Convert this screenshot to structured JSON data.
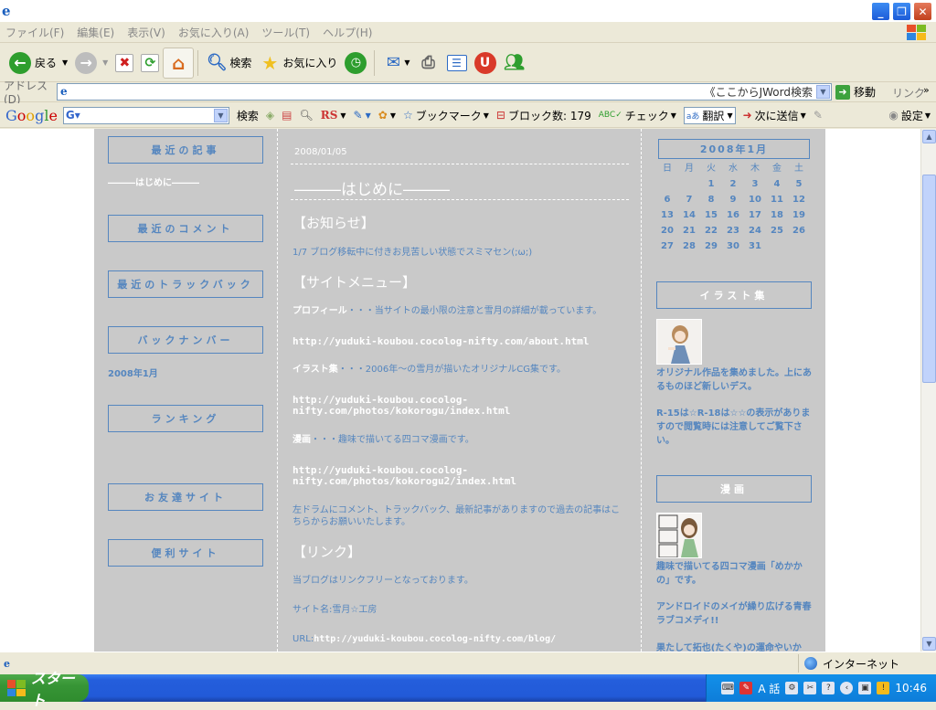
{
  "window": {
    "title": ""
  },
  "menubar": {
    "items": [
      "ファイル(F)",
      "編集(E)",
      "表示(V)",
      "お気に入り(A)",
      "ツール(T)",
      "ヘルプ(H)"
    ]
  },
  "toolbar": {
    "back": "戻る",
    "search": "検索",
    "favorites": "お気に入り"
  },
  "address": {
    "label": "アドレス(D)",
    "value": "《ここからJWord検索",
    "go": "移動",
    "links": "リンク"
  },
  "google_bar": {
    "search_label": "検索",
    "rs": "RS",
    "bookmarks": "ブックマーク",
    "blocked": "ブロック数: 179",
    "check": "チェック",
    "translate": "翻訳",
    "send": "次に送信",
    "settings": "設定"
  },
  "left_sidebar": {
    "recent_posts": "最近の記事",
    "recent_post_link": "―――はじめに―――",
    "recent_comments": "最近のコメント",
    "recent_trackbacks": "最近のトラックバック",
    "back_number": "バックナンバー",
    "back_number_link": "2008年1月",
    "ranking": "ランキング",
    "friends": "お友達サイト",
    "useful": "便利サイト"
  },
  "post": {
    "date": "2008/01/05",
    "title": "―――はじめに―――",
    "notice_heading": "【お知らせ】",
    "notice_text": "1/7 ブログ移転中に付きお見苦しい状態でスミマセン(;ω;)",
    "menu_heading": "【サイトメニュー】",
    "profile_label": "プロフィール",
    "profile_text": "・・・当サイトの最小限の注意と雪月の詳細が載っています。",
    "profile_url": "http://yuduki-koubou.cocolog-nifty.com/about.html",
    "illust_label": "イラスト集",
    "illust_text": "・・・2006年～の雪月が描いたオリジナルCG集です。",
    "illust_url": "http://yuduki-koubou.cocolog-nifty.com/photos/kokorogu/index.html",
    "manga_label": "漫画",
    "manga_text": "・・・趣味で描いてる四コマ漫画です。",
    "manga_url": "http://yuduki-koubou.cocolog-nifty.com/photos/kokorogu2/index.html",
    "left_nav_text": "左ドラムにコメント、トラックバック、最新記事がありますので過去の記事はこちらからお願いいたします。",
    "link_heading": "【リンク】",
    "link_free": "当ブログはリンクフリーとなっております。",
    "site_name": "サイト名:雪月☆工房",
    "url_label": "URL:",
    "url_value": "http://yuduki-koubou.cocolog-nifty.com/blog/"
  },
  "right_sidebar": {
    "calendar_title": "2008年1月",
    "weekdays": [
      "日",
      "月",
      "火",
      "水",
      "木",
      "金",
      "土"
    ],
    "weeks": [
      [
        "",
        "",
        "1",
        "2",
        "3",
        "4",
        "5"
      ],
      [
        "6",
        "7",
        "8",
        "9",
        "10",
        "11",
        "12"
      ],
      [
        "13",
        "14",
        "15",
        "16",
        "17",
        "18",
        "19"
      ],
      [
        "20",
        "21",
        "22",
        "23",
        "24",
        "25",
        "26"
      ],
      [
        "27",
        "28",
        "29",
        "30",
        "31",
        "",
        ""
      ]
    ],
    "illust_title": "イラスト集",
    "illust_desc": "オリジナル作品を集めました。上にあるものほど新しいデス。",
    "illust_note": "R-15は☆R-18は☆☆の表示がありますので閲覧時には注意してご覧下さい。",
    "manga_title": "漫画",
    "manga_desc": "趣味で描いてる四コマ漫画「めかかの」です。",
    "manga_desc2": "アンドロイドのメイが繰り広げる青春ラブコメディ!!",
    "manga_desc3": "果たして拓也(たくや)の運命やいか"
  },
  "status": {
    "zone": "インターネット"
  },
  "taskbar": {
    "start": "スタート",
    "clock": "10:46",
    "ime": "A 話"
  }
}
